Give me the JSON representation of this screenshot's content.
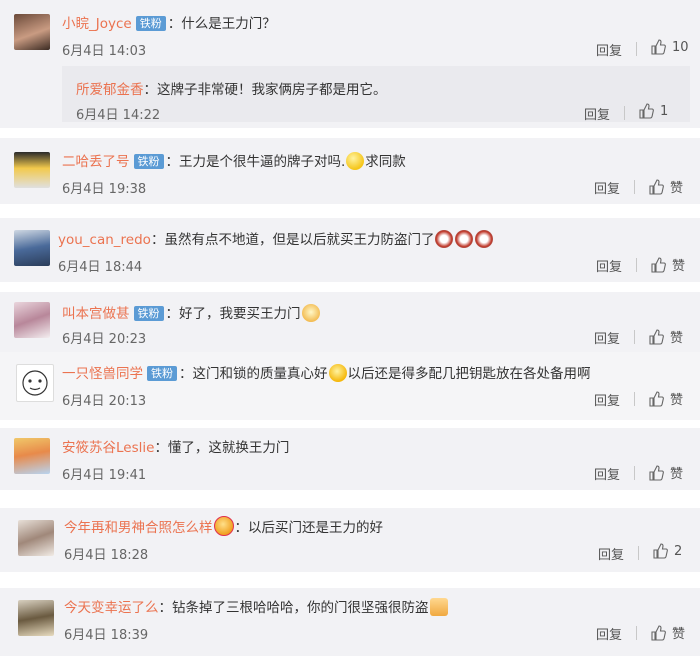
{
  "colors": {
    "username": "#eb7350",
    "badge_bg": "#5b9bd5",
    "card_bg": "#f2f2f5",
    "reply_bg": "#eaeaee"
  },
  "comments": [
    {
      "username": "小睆_Joyce",
      "badge": "铁粉",
      "text": "：什么是王力门？",
      "time": "6月4日 14:03",
      "reply_label": "回复",
      "likes": "10",
      "sub": {
        "username": "所爱郁金香",
        "text": "：这牌子非常硬！我家俩房子都是用它。",
        "time": "6月4日 14:22",
        "reply_label": "回复",
        "likes": "1"
      }
    },
    {
      "username": "二哈丢了号",
      "badge": "铁粉",
      "text_a": "：王力是个很牛逼的牌子对吗.",
      "text_b": "求同款",
      "emoji": "smirk-emoji",
      "time": "6月4日 19:38",
      "reply_label": "回复",
      "likes": "赞"
    },
    {
      "username": "you_can_redo",
      "text": "：虽然有点不地道，但是以后就买王力防盗门了",
      "emoji": "crying-emoji",
      "time": "6月4日 18:44",
      "reply_label": "回复",
      "likes": "赞"
    },
    {
      "username": "叫本宫做甚",
      "badge": "铁粉",
      "text": "：好了，我要买王力门",
      "emoji": "cat-emoji",
      "time": "6月4日 20:23",
      "reply_label": "回复",
      "likes": "赞",
      "sub": {
        "username": "一只怪兽同学",
        "badge": "铁粉",
        "text_a": "：这门和锁的质量真心好",
        "text_b": "以后还是得多配几把钥匙放在各处备用啊",
        "emoji": "laugh-emoji",
        "time": "6月4日 20:13",
        "reply_label": "回复",
        "likes": "赞"
      }
    },
    {
      "username": "安筱苏谷Leslie",
      "text": "：懂了，这就换王力门",
      "time": "6月4日 19:41",
      "reply_label": "回复",
      "likes": "赞"
    },
    {
      "username": "今年再和男神合照怎么样",
      "text": "：以后买门还是王力的好",
      "emoji": "heart-eyes-emoji",
      "time": "6月4日 18:28",
      "reply_label": "回复",
      "likes": "2"
    },
    {
      "username": "今天变幸运了么",
      "text": "：钻条掉了三根哈哈哈，你的门很坚强很防盗",
      "emoji": "thumbs-up-emoji",
      "time": "6月4日 18:39",
      "reply_label": "回复",
      "likes": "赞"
    }
  ]
}
